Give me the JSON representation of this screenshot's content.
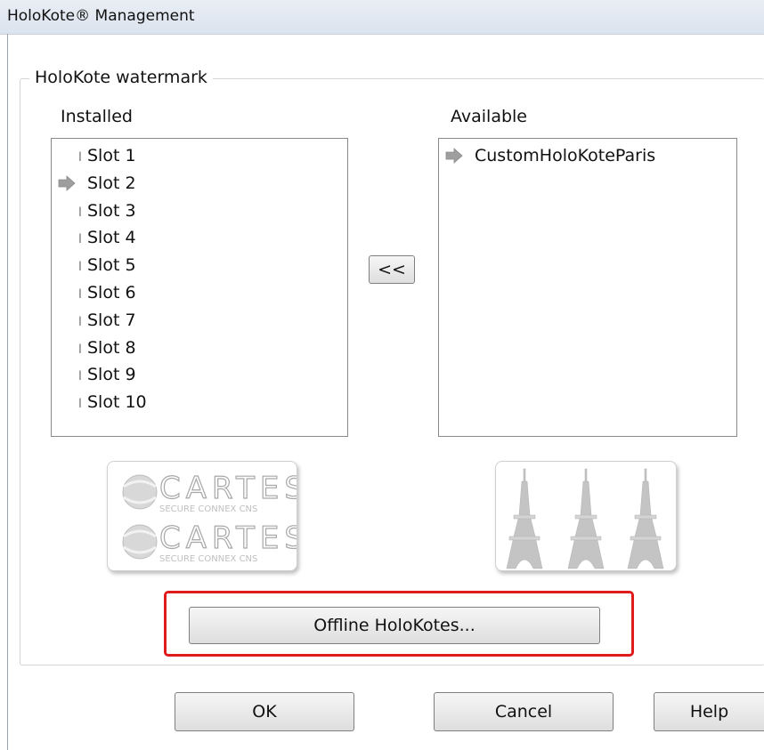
{
  "window": {
    "title": "HoloKote® Management"
  },
  "group": {
    "label": "HoloKote watermark"
  },
  "installed": {
    "label": "Installed",
    "items": [
      {
        "label": "Slot 1",
        "selected": false
      },
      {
        "label": "Slot 2",
        "selected": true
      },
      {
        "label": "Slot 3",
        "selected": false
      },
      {
        "label": "Slot 4",
        "selected": false
      },
      {
        "label": "Slot 5",
        "selected": false
      },
      {
        "label": "Slot 6",
        "selected": false
      },
      {
        "label": "Slot 7",
        "selected": false
      },
      {
        "label": "Slot 8",
        "selected": false
      },
      {
        "label": "Slot 9",
        "selected": false
      },
      {
        "label": "Slot 10",
        "selected": false
      }
    ]
  },
  "available": {
    "label": "Available",
    "items": [
      {
        "label": "CustomHoloKoteParis",
        "selected": true
      }
    ]
  },
  "move_button": {
    "label": "<<"
  },
  "preview_installed": {
    "word": "CARTES",
    "subtext": "SECURE CONNEX CNS"
  },
  "offline_button": {
    "label": "Offline HoloKotes..."
  },
  "footer": {
    "ok": "OK",
    "cancel": "Cancel",
    "help": "Help"
  },
  "colors": {
    "highlight": "#e01b1b",
    "arrow": "#9e9e9e"
  }
}
